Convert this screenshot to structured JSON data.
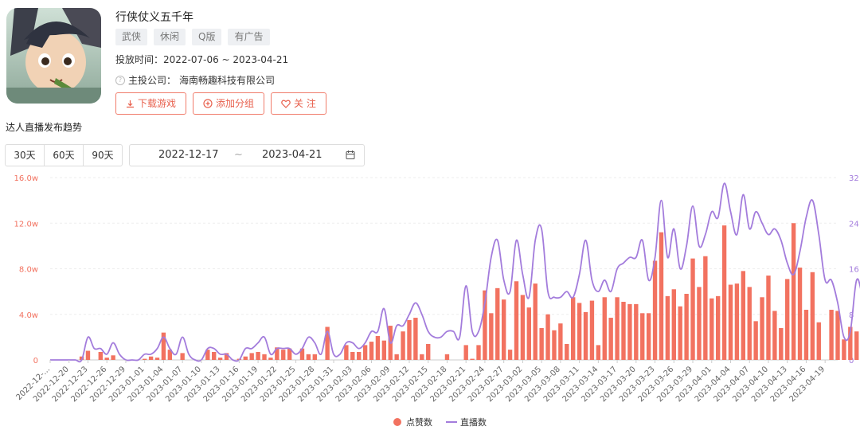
{
  "game": {
    "title": "行侠仗义五千年",
    "tags": [
      "武侠",
      "休闲",
      "Q版",
      "有广告"
    ],
    "period": "投放时间：2022-07-06 ~ 2023-04-21",
    "company_label": "主投公司：",
    "company": "海南畅趣科技有限公司",
    "cover_icon": "game-cover-image"
  },
  "buttons": {
    "download": "下载游戏",
    "group": "添加分组",
    "follow": "关 注"
  },
  "section_title": "达人直播发布趋势",
  "range_options": [
    "30天",
    "60天",
    "90天"
  ],
  "date_range": {
    "start": "2022-12-17",
    "sep": "~",
    "end": "2023-04-21",
    "icon": "calendar-icon"
  },
  "colors": {
    "bar": "#f27260",
    "line": "#a37cdc",
    "accent": "#e8604d"
  },
  "chart_data": {
    "type": "bar",
    "x_start": "2022-12-17",
    "x_end": "2023-04-21",
    "x_tick_labels": [
      "2022-12-...",
      "2022-12-20",
      "2022-12-23",
      "2022-12-26",
      "2022-12-29",
      "2023-01-01",
      "2023-01-04",
      "2023-01-07",
      "2023-01-10",
      "2023-01-13",
      "2023-01-16",
      "2023-01-19",
      "2023-01-22",
      "2023-01-25",
      "2023-01-28",
      "2023-01-31",
      "2023-02-03",
      "2023-02-06",
      "2023-02-09",
      "2023-02-12",
      "2023-02-15",
      "2023-02-18",
      "2023-02-21",
      "2023-02-24",
      "2023-02-27",
      "2023-03-02",
      "2023-03-05",
      "2023-03-08",
      "2023-03-11",
      "2023-03-14",
      "2023-03-17",
      "2023-03-20",
      "2023-03-23",
      "2023-03-26",
      "2023-03-29",
      "2023-04-01",
      "2023-04-04",
      "2023-04-07",
      "2023-04-10",
      "2023-04-13",
      "2023-04-16",
      "2023-04-19"
    ],
    "y_left_ticks": [
      "0",
      "4.0w",
      "8.0w",
      "12.0w",
      "16.0w"
    ],
    "y_right_ticks": [
      "0",
      "8",
      "16",
      "24",
      "32"
    ],
    "ylim_left": [
      0,
      16
    ],
    "ylim_right": [
      0,
      32
    ],
    "series": [
      {
        "name": "点赞数",
        "axis": "left",
        "type": "bar",
        "values": [
          0,
          0,
          0,
          0,
          0,
          0.3,
          0.8,
          0,
          0.7,
          0.2,
          0.4,
          0,
          0,
          0,
          0,
          0.1,
          0.3,
          0.2,
          2.4,
          0.9,
          0,
          0.6,
          0,
          0,
          0,
          0.9,
          0.7,
          0.2,
          0.6,
          0,
          0.1,
          0.3,
          0.6,
          0.7,
          0.5,
          0.2,
          1.1,
          0.9,
          1.0,
          0,
          1.0,
          0.5,
          0.5,
          0,
          2.9,
          0,
          0,
          1.3,
          0.7,
          0.7,
          1.3,
          1.6,
          2.1,
          1.7,
          3.0,
          0.5,
          2.5,
          3.5,
          3.7,
          0.5,
          1.4,
          0,
          0,
          0.5,
          0,
          0,
          1.3,
          0.1,
          1.3,
          6.1,
          4.1,
          6.3,
          5.3,
          0.9,
          6.9,
          5.7,
          4.6,
          6.7,
          2.8,
          4.0,
          2.6,
          3.2,
          1.4,
          5.5,
          5.0,
          4.2,
          5.2,
          1.3,
          5.5,
          3.7,
          5.5,
          5.1,
          4.9,
          4.9,
          4.1,
          4.1,
          8.7,
          11.2,
          5.6,
          6.2,
          4.7,
          5.8,
          8.9,
          6.4,
          9.1,
          5.4,
          5.6,
          11.8,
          6.6,
          6.7,
          7.8,
          6.4,
          3.4,
          5.5,
          7.4,
          4.3,
          2.8,
          7.1,
          12.0,
          8.1,
          4.4,
          7.7,
          3.3,
          0,
          4.4,
          4.3,
          1.8,
          2.9,
          2.5
        ]
      },
      {
        "name": "直播数",
        "axis": "right",
        "type": "line",
        "values": [
          0,
          0,
          0,
          0,
          0,
          0,
          4,
          2,
          2,
          1,
          3,
          1,
          0,
          0,
          0,
          1,
          1,
          2,
          4,
          2,
          1,
          4,
          1,
          0,
          0,
          2,
          2,
          1,
          1,
          0,
          0,
          2,
          2,
          3,
          4,
          1,
          2,
          2,
          2,
          1,
          2,
          4,
          3,
          1,
          5,
          1,
          1,
          3,
          3,
          2,
          3,
          5,
          5,
          9,
          3,
          6,
          6,
          8,
          10,
          8,
          5,
          4,
          4,
          5,
          5,
          4,
          13,
          5,
          5,
          10,
          18,
          21,
          14,
          12,
          21,
          15,
          11,
          21,
          23,
          12,
          11,
          11,
          12,
          11,
          15,
          21,
          14,
          12,
          14,
          12,
          16,
          17,
          18,
          18,
          21,
          14,
          18,
          28,
          18,
          23,
          16,
          20,
          27,
          20,
          22,
          26,
          25,
          31,
          26,
          22,
          29,
          23,
          26,
          24,
          22,
          23,
          21,
          17,
          15,
          19,
          25,
          28,
          22,
          14,
          14,
          10,
          4,
          5,
          14,
          11,
          9,
          9
        ]
      }
    ],
    "legend": [
      "点赞数",
      "直播数"
    ],
    "legend_position": "bottom-center"
  }
}
